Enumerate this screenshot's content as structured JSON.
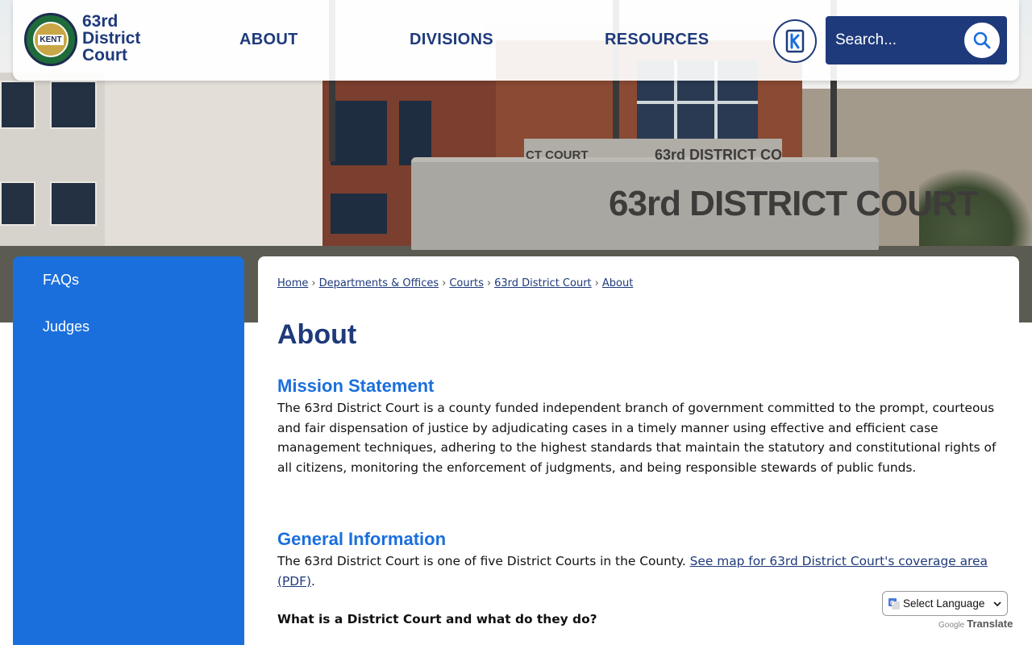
{
  "site": {
    "logo_lines": [
      "63rd",
      "District",
      "Court"
    ],
    "seal_text": "KENT"
  },
  "nav": {
    "items": [
      "ABOUT",
      "DIVISIONS",
      "RESOURCES"
    ]
  },
  "search": {
    "placeholder": "Search..."
  },
  "hero": {
    "sign_large": "63rd DISTRICT COURT",
    "sign_small": "63rd DISTRICT CO",
    "sign_small2": "CT COURT"
  },
  "sidebar": {
    "items": [
      {
        "label": "FAQs"
      },
      {
        "label": "Judges"
      }
    ]
  },
  "breadcrumb": {
    "items": [
      "Home",
      "Departments & Offices",
      "Courts",
      "63rd District Court",
      "About"
    ]
  },
  "page": {
    "title": "About",
    "mission_heading": "Mission Statement",
    "mission_text": "The 63rd District Court is a county funded independent branch of government committed to the prompt, courteous and fair dispensation of justice by adjudicating cases in a timely manner using effective and efficient case management techniques, adhering to the highest standards that maintain the statutory and constitutional rights of all citizens, monitoring the enforcement of judgments, and being responsible stewards of public funds.",
    "general_heading": "General Information",
    "general_text": "The 63rd District Court is one of five District Courts in the County. ",
    "general_link": "See map for 63rd District Court's coverage area (PDF)",
    "general_text_end": ".",
    "question": "What is a District Court and what do they do?"
  },
  "translate": {
    "select_label": "Select Language",
    "powered_by": "Google",
    "translate_label": "Translate"
  },
  "colors": {
    "navy": "#1e3a7b",
    "accent_blue": "#1a6fdc"
  }
}
